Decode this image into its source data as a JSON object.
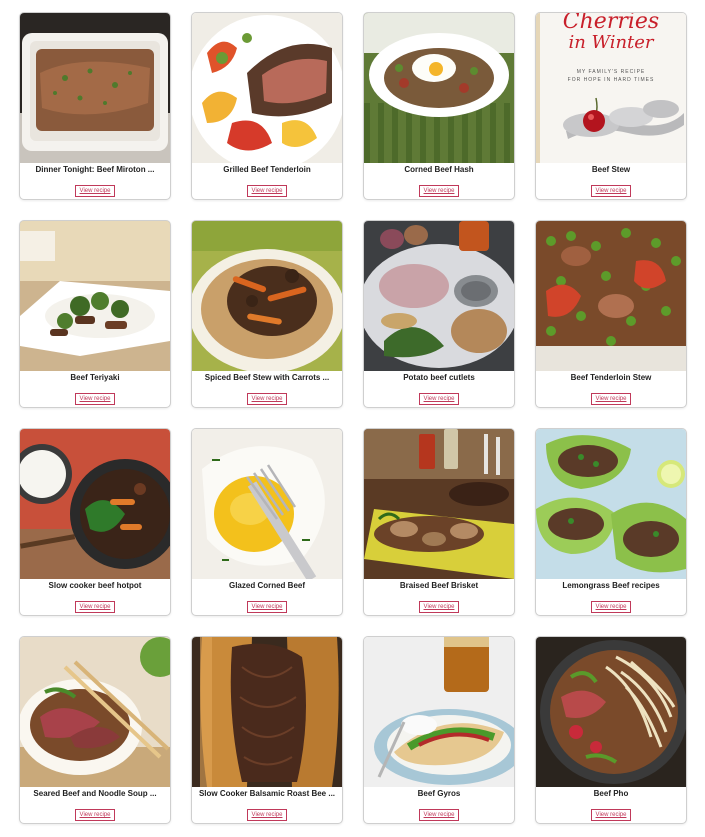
{
  "recipes": [
    {
      "title": "Dinner Tonight: Beef Miroton ...",
      "button": "View recipe",
      "image": "beef-miroton-casserole-photo"
    },
    {
      "title": "Grilled Beef Tenderloin",
      "button": "View recipe",
      "image": "grilled-beef-tenderloin-photo"
    },
    {
      "title": "Corned Beef Hash",
      "button": "View recipe",
      "image": "corned-beef-hash-photo"
    },
    {
      "title": "Beef Stew",
      "button": "View recipe",
      "image": "cherries-in-winter-book-cover"
    },
    {
      "title": "Beef Teriyaki",
      "button": "View recipe",
      "image": "beef-teriyaki-photo"
    },
    {
      "title": "Spiced Beef Stew with Carrots ...",
      "button": "View recipe",
      "image": "spiced-beef-stew-photo"
    },
    {
      "title": "Potato beef cutlets",
      "button": "View recipe",
      "image": "potato-beef-cutlets-photo"
    },
    {
      "title": "Beef Tenderloin Stew",
      "button": "View recipe",
      "image": "beef-tenderloin-stew-photo"
    },
    {
      "title": "Slow cooker beef hotpot",
      "button": "View recipe",
      "image": "slow-cooker-hotpot-photo"
    },
    {
      "title": "Glazed Corned Beef",
      "button": "View recipe",
      "image": "glazed-corned-beef-photo"
    },
    {
      "title": "Braised Beef Brisket",
      "button": "View recipe",
      "image": "braised-beef-brisket-photo"
    },
    {
      "title": "Lemongrass Beef recipes",
      "button": "View recipe",
      "image": "lemongrass-beef-photo"
    },
    {
      "title": "Seared Beef and Noodle Soup ...",
      "button": "View recipe",
      "image": "seared-beef-noodle-soup-photo"
    },
    {
      "title": "Slow Cooker Balsamic Roast Bee ...",
      "button": "View recipe",
      "image": "balsamic-roast-beef-sandwich-photo"
    },
    {
      "title": "Beef Gyros",
      "button": "View recipe",
      "image": "beef-gyros-photo"
    },
    {
      "title": "Beef Pho",
      "button": "View recipe",
      "image": "beef-pho-photo"
    }
  ],
  "book_cover": {
    "title_line1": "Cherries",
    "title_line2": "in Winter",
    "subtitle_line1": "MY FAMILY'S RECIPE",
    "subtitle_line2": "FOR HOPE IN HARD TIMES"
  }
}
